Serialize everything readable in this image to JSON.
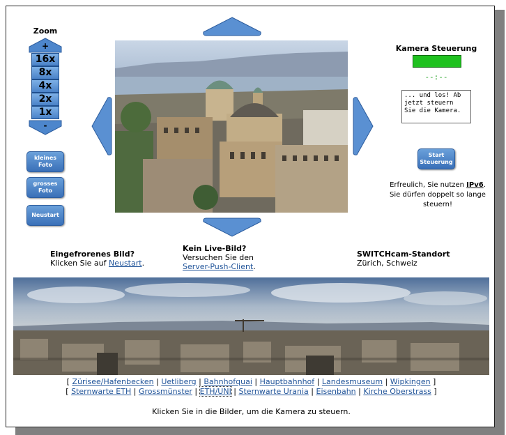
{
  "zoom": {
    "title": "Zoom",
    "plus": "+",
    "minus": "-",
    "levels": [
      "16x",
      "8x",
      "4x",
      "2x",
      "1x"
    ]
  },
  "left_buttons": {
    "small_photo": "kleines Foto",
    "large_photo": "grosses Foto",
    "restart": "Neustart"
  },
  "camera_control": {
    "title": "Kamera Steuerung",
    "status_color": "#1fc11f",
    "timer": "--:--",
    "message": "... und los! Ab jetzt steuern Sie die Kamera.",
    "start_button": "Start Steuerung",
    "ipv6_pre": "Erfreulich, Sie nutzen",
    "ipv6_bold": "IPv6",
    "ipv6_post": ". Sie dürfen doppelt so lange steuern!"
  },
  "info": {
    "frozen_title": "Eingefrorenes Bild?",
    "frozen_text": "Klicken Sie auf",
    "frozen_link": "Neustart",
    "frozen_end": ".",
    "nolive_title": "Kein Live-Bild?",
    "nolive_text": "Versuchen Sie den",
    "nolive_link": "Server-Push-Client",
    "nolive_end": ".",
    "location_title": "SWITCHcam-Standort",
    "location_text": "Zürich, Schweiz"
  },
  "preset_links": {
    "row1": [
      "Zürisee/Hafenbecken",
      "Uetliberg",
      "Bahnhofquai",
      "Hauptbahnhof",
      "Landesmuseum",
      "Wipkingen"
    ],
    "row2": [
      "Sternwarte ETH",
      "Grossmünster",
      "ETH/UNI",
      "Sternwarte Urania",
      "Eisenbahn",
      "Kirche Oberstrass"
    ]
  },
  "footer": "Klicken Sie in die Bilder, um die Kamera zu steuern.",
  "colors": {
    "accent_blue": "#4a82c8",
    "link": "#22559a"
  }
}
